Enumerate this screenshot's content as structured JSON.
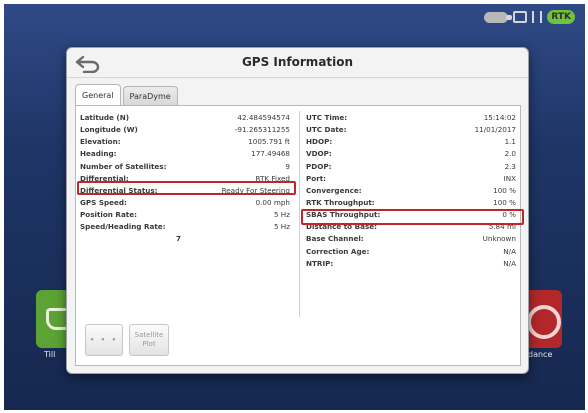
{
  "dialog": {
    "title": "GPS Information"
  },
  "tabs": [
    {
      "label": "General",
      "active": true
    },
    {
      "label": "ParaDyme",
      "active": false
    }
  ],
  "left_rows": [
    {
      "label": "Latitude (N)",
      "value": "42.484594574"
    },
    {
      "label": "Longitude (W)",
      "value": "-91.265311255"
    },
    {
      "label": "Elevation:",
      "value": "1005.791 ft"
    },
    {
      "label": "Heading:",
      "value": "177.49468"
    },
    {
      "label": "Number of Satellites:",
      "value": "9"
    },
    {
      "label": "Differential:",
      "value": "RTK Fixed"
    },
    {
      "label": "Differential Status:",
      "value": "Ready For Steering"
    },
    {
      "label": "GPS Speed:",
      "value": "0.00 mph"
    },
    {
      "label": "Position Rate:",
      "value": "5 Hz"
    },
    {
      "label": "Speed/Heading Rate:",
      "value": "5 Hz"
    }
  ],
  "left_extra": "7",
  "right_rows": [
    {
      "label": "UTC Time:",
      "value": "15:14:02"
    },
    {
      "label": "UTC Date:",
      "value": "11/01/2017"
    },
    {
      "label": "HDOP:",
      "value": "1.1"
    },
    {
      "label": "VDOP:",
      "value": "2.0"
    },
    {
      "label": "PDOP:",
      "value": "2.3"
    },
    {
      "label": "Port:",
      "value": "INX"
    },
    {
      "label": "Convergence:",
      "value": "100 %"
    },
    {
      "label": "RTK Throughput:",
      "value": "100 %"
    },
    {
      "label": "SBAS Throughput:",
      "value": "0 %"
    },
    {
      "label": "Distance to Base:",
      "value": "5.84 mi"
    },
    {
      "label": "Base Channel:",
      "value": "Unknown"
    },
    {
      "label": "Correction Age:",
      "value": "N/A"
    },
    {
      "label": "NTRIP:",
      "value": "N/A"
    }
  ],
  "buttons": {
    "more": "• • •",
    "satellite_plot": "Satellite Plot"
  },
  "status_bar": {
    "gps_badge": "RTK"
  },
  "background_tiles": {
    "left_label": "Till",
    "right_label": "dance"
  },
  "colors": {
    "highlight": "#c0262e",
    "background": "#1f3566",
    "gps_badge": "#6ec23c"
  },
  "icons": [
    "back-arrow-icon",
    "key-icon",
    "display-icon",
    "gps-status-icon"
  ]
}
